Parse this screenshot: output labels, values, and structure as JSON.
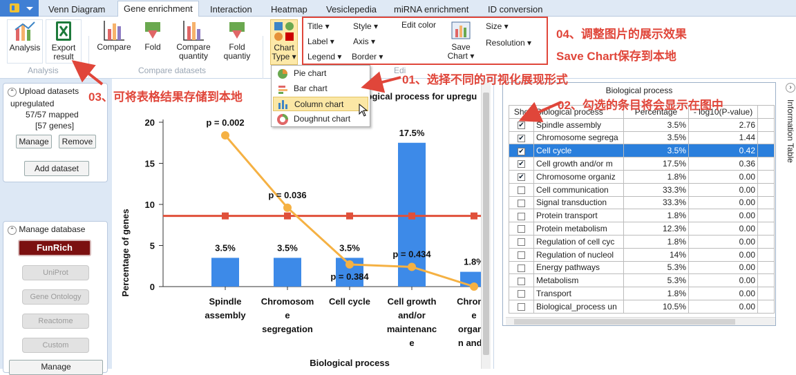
{
  "tabs": [
    "Venn Diagram",
    "Gene enrichment",
    "Interaction",
    "Heatmap",
    "Vesiclepedia",
    "miRNA enrichment",
    "ID conversion"
  ],
  "active_tab": "Gene enrichment",
  "ribbon": {
    "analysis": "Analysis",
    "export_1": "Export",
    "export_2": "result",
    "compare": "Compare",
    "fold": "Fold",
    "compare_quantity_1": "Compare",
    "compare_quantity_2": "quantity",
    "fold_quantity_1": "Fold",
    "fold_quantity_2": "quantiy",
    "chart_type_1": "Chart",
    "chart_type_2": "Type",
    "title": "Title",
    "label": "Label",
    "legend": "Legend",
    "style": "Style",
    "axis": "Axis",
    "border": "Border",
    "edit_color": "Edit color",
    "save_chart_1": "Save",
    "save_chart_2": "Chart",
    "size": "Size",
    "resolution": "Resolution",
    "group_analysis": "Analysis",
    "group_compare": "Compare datasets",
    "group_edit": "Edi"
  },
  "chart_menu": [
    "Pie chart",
    "Bar chart",
    "Column chart",
    "Doughnut chart"
  ],
  "upload": {
    "header": "Upload datasets",
    "dataset_name": "upregulated",
    "mapped": "57/57 mapped",
    "genes": "[57 genes]",
    "manage": "Manage",
    "remove": "Remove",
    "add": "Add dataset"
  },
  "database": {
    "header": "Manage database",
    "funrich": "FunRich",
    "uniprot": "UniProt",
    "go": "Gene Ontology",
    "reactome": "Reactome",
    "custom": "Custom",
    "manage": "Manage"
  },
  "annotations": {
    "a01": "01、选择不同的可视化展现形式",
    "a02": "02、勾选的条目将会显示在图中",
    "a03": "03、可将表格结果存储到本地",
    "a04": "04、调整图片的展示效果",
    "a04b": "Save Chart保存到本地"
  },
  "info_table": "Information Table",
  "table": {
    "title": "Biological process",
    "headers": [
      "Sho",
      "Biological process",
      "Percentage",
      "- log10(P-value)"
    ],
    "rows": [
      {
        "checked": true,
        "name": "Spindle assembly",
        "pct": "3.5%",
        "logp": "2.76"
      },
      {
        "checked": true,
        "name": "Chromosome segrega",
        "pct": "3.5%",
        "logp": "1.44"
      },
      {
        "checked": true,
        "name": "Cell cycle",
        "pct": "3.5%",
        "logp": "0.42"
      },
      {
        "checked": true,
        "name": "Cell growth and/or m",
        "pct": "17.5%",
        "logp": "0.36"
      },
      {
        "checked": true,
        "name": "Chromosome organiz",
        "pct": "1.8%",
        "logp": "0.00"
      },
      {
        "checked": false,
        "name": "Cell communication",
        "pct": "33.3%",
        "logp": "0.00"
      },
      {
        "checked": false,
        "name": "Signal transduction",
        "pct": "33.3%",
        "logp": "0.00"
      },
      {
        "checked": false,
        "name": "Protein transport",
        "pct": "1.8%",
        "logp": "0.00"
      },
      {
        "checked": false,
        "name": "Protein metabolism",
        "pct": "12.3%",
        "logp": "0.00"
      },
      {
        "checked": false,
        "name": "Regulation of cell cyc",
        "pct": "1.8%",
        "logp": "0.00"
      },
      {
        "checked": false,
        "name": "Regulation of nucleol",
        "pct": "14%",
        "logp": "0.00"
      },
      {
        "checked": false,
        "name": "Energy pathways",
        "pct": "5.3%",
        "logp": "0.00"
      },
      {
        "checked": false,
        "name": "Metabolism",
        "pct": "5.3%",
        "logp": "0.00"
      },
      {
        "checked": false,
        "name": "Transport",
        "pct": "1.8%",
        "logp": "0.00"
      },
      {
        "checked": false,
        "name": "Biological_process un",
        "pct": "10.5%",
        "logp": "0.00"
      }
    ]
  },
  "chart_data": {
    "type": "bar",
    "title": "Biological process for upregu",
    "xlabel": "Biological process",
    "ylabel": "Percentage of genes",
    "ylim": [
      0,
      20
    ],
    "yticks": [
      0,
      5,
      10,
      15,
      20
    ],
    "categories": [
      [
        "Spindle",
        "assembly"
      ],
      [
        "Chromosom",
        "e",
        "segregation"
      ],
      [
        "Cell cycle"
      ],
      [
        "Cell growth",
        "and/or",
        "maintenanc",
        "e"
      ],
      [
        "Chromo",
        "e",
        "organiz",
        "n and b"
      ]
    ],
    "series": [
      {
        "values": [
          3.5,
          3.5,
          3.5,
          17.5,
          1.8
        ]
      }
    ],
    "bar_labels": [
      "3.5%",
      "3.5%",
      "3.5%",
      "17.5%",
      "1.8%"
    ],
    "line_series": {
      "values": [
        18.4,
        9.6,
        2.7,
        2.4,
        0.0
      ],
      "labels": [
        "p = 0.002",
        "p = 0.036",
        "p = 0.384",
        "p = 0.434",
        ""
      ]
    },
    "threshold_line": {
      "value": 8.6
    },
    "colors": {
      "bar": "#3d8ae8",
      "line": "#f5b143",
      "threshold": "#e0503a"
    }
  }
}
